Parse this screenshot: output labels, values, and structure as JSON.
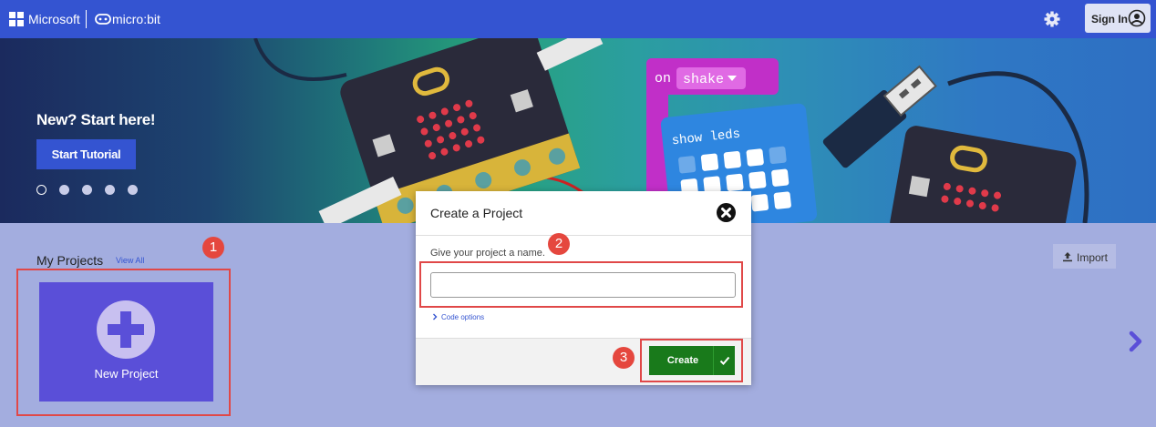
{
  "header": {
    "brand": "Microsoft",
    "product": "micro:bit",
    "settings_icon": "gear-icon",
    "signin_label": "Sign In",
    "signin_icon": "user-circle-icon"
  },
  "hero": {
    "title": "New? Start here!",
    "button_label": "Start Tutorial",
    "carousel_total": 5,
    "carousel_active": 1,
    "block_on": "on",
    "block_event": "shake",
    "block_show": "show leds"
  },
  "projects": {
    "title": "My Projects",
    "view_all": "View All",
    "new_project_label": "New Project",
    "import_label": "Import"
  },
  "modal": {
    "title": "Create a Project",
    "prompt": "Give your project a name.",
    "input_value": "",
    "code_options": "Code options",
    "create_label": "Create"
  },
  "annotations": {
    "badge1": "1",
    "badge2": "2",
    "badge3": "3"
  },
  "colors": {
    "topbar": "#3454d1",
    "page_bg": "#a3addf",
    "new_project_tile": "#5a4fd8",
    "create_button": "#197a1b",
    "annotation": "#e04848"
  }
}
